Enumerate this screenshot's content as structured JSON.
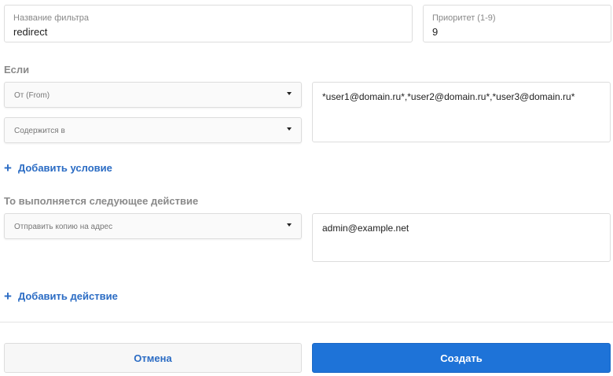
{
  "filter": {
    "name_label": "Название фильтра",
    "name_value": "redirect",
    "priority_label": "Приоритет (1-9)",
    "priority_value": "9"
  },
  "conditions": {
    "title": "Если",
    "field_select": "От (From)",
    "operator_select": "Содержится в",
    "value": "*user1@domain.ru*,*user2@domain.ru*,*user3@domain.ru*",
    "add_label": "Добавить условие"
  },
  "actions": {
    "title": "То выполняется следующее действие",
    "action_select": "Отправить копию на адрес",
    "value": "admin@example.net",
    "add_label": "Добавить действие"
  },
  "buttons": {
    "cancel": "Отмена",
    "create": "Создать"
  },
  "colors": {
    "accent": "#1e73d8",
    "link": "#2b6cc4"
  }
}
